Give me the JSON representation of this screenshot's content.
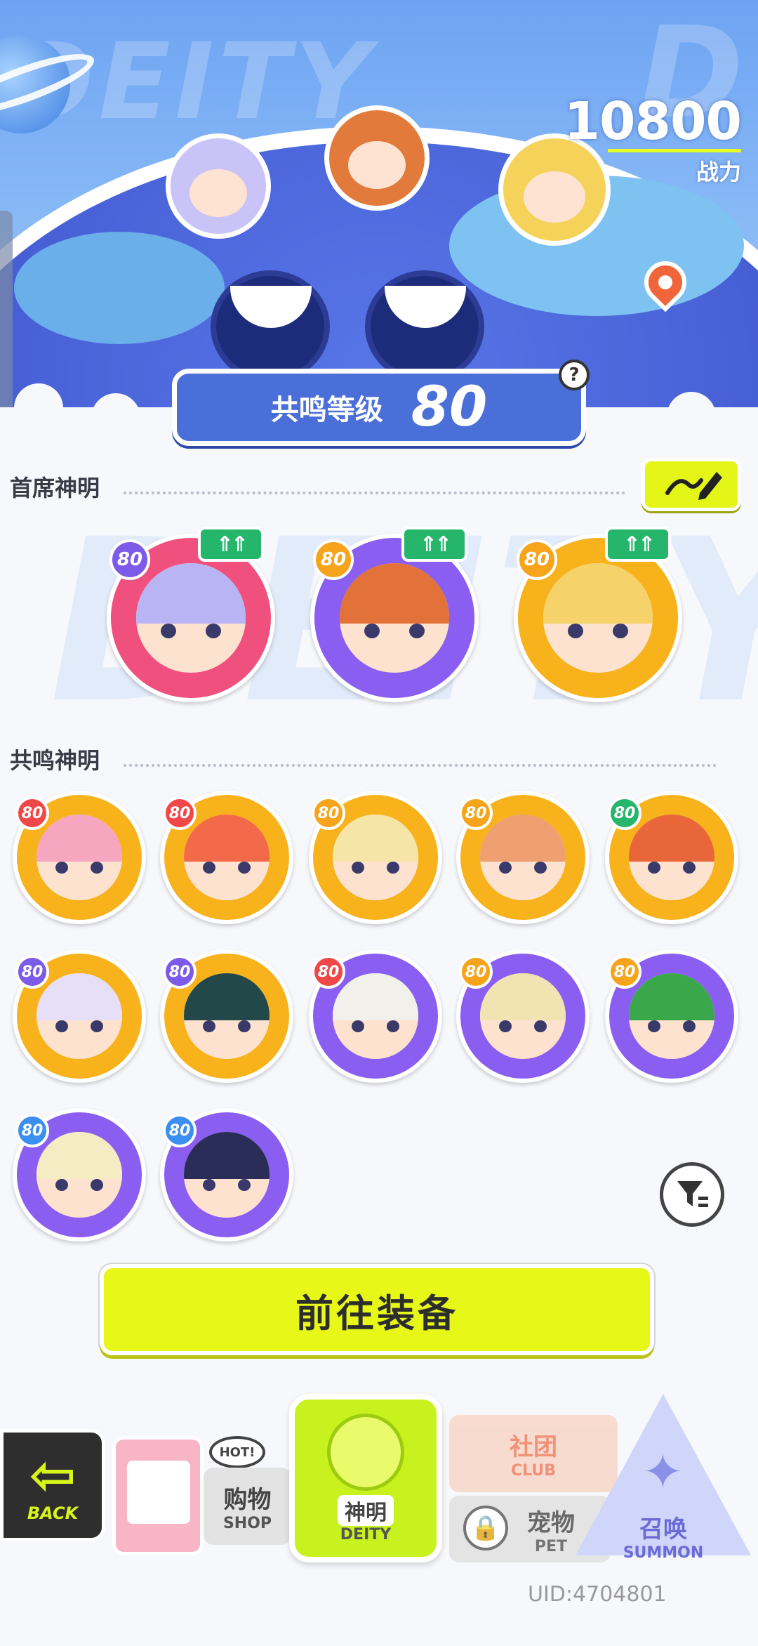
{
  "header": {
    "combat_power_value": "10800",
    "combat_power_label": "战力",
    "resonance_label": "共鸣等级",
    "resonance_level": "80",
    "help_icon": "?"
  },
  "sections": {
    "chief_title": "首席神明",
    "resonance_title": "共鸣神明"
  },
  "chief_deities": [
    {
      "level": "80",
      "badge_color": "#7c5be8",
      "ring": "#f0507e",
      "hair": "#b9b5f4",
      "up": true
    },
    {
      "level": "80",
      "badge_color": "#f5a41b",
      "ring": "#8a5ef0",
      "hair": "#e2723a",
      "up": true
    },
    {
      "level": "80",
      "badge_color": "#f5a41b",
      "ring": "#f7b21c",
      "hair": "#f6d36a",
      "up": true
    }
  ],
  "resonance_deities": [
    {
      "level": "80",
      "badge_color": "#f04848",
      "ring": "#f7b21c",
      "hair": "#f7a6c0"
    },
    {
      "level": "80",
      "badge_color": "#f04848",
      "ring": "#f7b21c",
      "hair": "#f26a4a"
    },
    {
      "level": "80",
      "badge_color": "#f5a41b",
      "ring": "#f7b21c",
      "hair": "#f5e6a8"
    },
    {
      "level": "80",
      "badge_color": "#f5a41b",
      "ring": "#f7b21c",
      "hair": "#f0a070"
    },
    {
      "level": "80",
      "badge_color": "#25b66b",
      "ring": "#f7b21c",
      "hair": "#e8663a"
    },
    {
      "level": "80",
      "badge_color": "#7c5be8",
      "ring": "#f7b21c",
      "hair": "#e7dff7"
    },
    {
      "level": "80",
      "badge_color": "#7c5be8",
      "ring": "#f7b21c",
      "hair": "#23484a"
    },
    {
      "level": "80",
      "badge_color": "#f04848",
      "ring": "#8a5ef0",
      "hair": "#f2f0ea"
    },
    {
      "level": "80",
      "badge_color": "#f5a41b",
      "ring": "#8a5ef0",
      "hair": "#f2e3b2"
    },
    {
      "level": "80",
      "badge_color": "#f5a41b",
      "ring": "#8a5ef0",
      "hair": "#3aa84a"
    },
    {
      "level": "80",
      "badge_color": "#3a8ff0",
      "ring": "#8a5ef0",
      "hair": "#f6ecc4"
    },
    {
      "level": "80",
      "badge_color": "#3a8ff0",
      "ring": "#8a5ef0",
      "hair": "#2a2d58"
    }
  ],
  "equip_button": "前往装备",
  "nav": {
    "back_en": "BACK",
    "shop_zh": "购物",
    "shop_en": "SHOP",
    "shop_hot": "HOT!",
    "deity_zh": "神明",
    "deity_en": "DEITY",
    "club_zh": "社团",
    "club_en": "CLUB",
    "pet_zh": "宠物",
    "pet_en": "PET",
    "summon_zh": "召唤",
    "summon_en": "SUMMON"
  },
  "uid": "UID:4704801",
  "colors": {
    "accent_lime": "#e4f518",
    "primary_blue": "#4a6fd8"
  },
  "icons": {
    "edit": "pencil-icon",
    "filter": "filter-icon",
    "back": "back-arrow-icon",
    "up": "upgrade-arrow-icon",
    "location": "map-pin-icon"
  }
}
